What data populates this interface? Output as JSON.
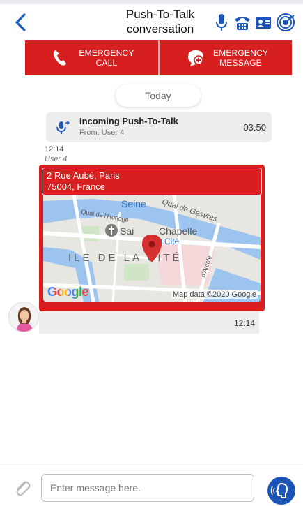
{
  "header": {
    "title_line1": "Push-To-Talk",
    "title_line2": "conversation",
    "icons": [
      "back-chevron-icon",
      "microphone-icon",
      "phone-call-icon",
      "contact-card-icon",
      "radio-signal-icon"
    ]
  },
  "emergency": {
    "call_line1": "EMERGENCY",
    "call_line2": "CALL",
    "message_line1": "EMERGENCY",
    "message_line2": "MESSAGE"
  },
  "conversation": {
    "date_label": "Today",
    "ptt_title": "Incoming Push-To-Talk",
    "ptt_from": "From: User 4",
    "ptt_time": "03:50",
    "message_time": "12:14",
    "message_user": "User 4",
    "location_line1": "2 Rue Aubé, Paris",
    "location_line2": "75004, France",
    "map_google": "Google",
    "map_credit": "Map data ©2020 Google",
    "map_labels": {
      "seine": "Seine",
      "quai_horloge": "Quai de l'Horloge",
      "quai_gesvres": "Quai de Gesvres",
      "sainte_chapelle_a": "Sai",
      "sainte_chapelle_b": "Chapelle",
      "cite": "Cité",
      "ile": "ILE DE LA CITÉ",
      "arcole": "d'Arcole"
    },
    "location_time": "12:14"
  },
  "composer": {
    "placeholder": "Enter message here."
  },
  "colors": {
    "emergency_red": "#d81f1f",
    "accent_blue": "#1b55b8"
  }
}
